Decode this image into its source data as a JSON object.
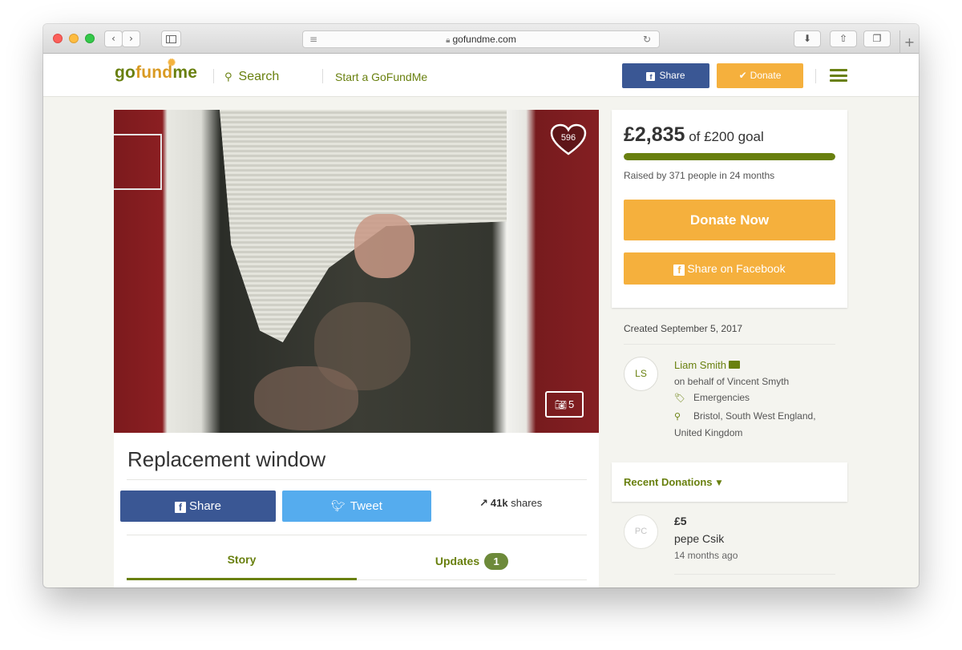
{
  "browser": {
    "url": "gofundme.com",
    "nav_back": "‹",
    "nav_forward": "›",
    "new_tab": "+"
  },
  "header": {
    "logo_go": "go",
    "logo_fund": "fund",
    "logo_me": "me",
    "search_label": "Search",
    "start_label": "Start a GoFundMe",
    "share_label": "Share",
    "donate_label": "Donate"
  },
  "campaign": {
    "hearts": "596",
    "photo_count": "5",
    "title": "Replacement window",
    "share_label": "Share",
    "tweet_label": "Tweet",
    "shares_count": "41k",
    "shares_label": "shares",
    "tabs": {
      "story": "Story",
      "updates": "Updates",
      "updates_count": "1"
    }
  },
  "donation": {
    "raised": "£2,835",
    "goal_text": "of £200 goal",
    "progress_fraction": 1.0,
    "raised_by": "Raised by 371 people in 24 months",
    "donate_now": "Donate Now",
    "share_facebook": "Share on Facebook"
  },
  "organizer": {
    "created": "Created September 5, 2017",
    "initials": "LS",
    "name": "Liam Smith",
    "behalf": "on behalf of Vincent Smyth",
    "category": "Emergencies",
    "location_line1": "Bristol, South West England,",
    "location_line2": "United Kingdom"
  },
  "recent": {
    "title": "Recent Donations",
    "items": [
      {
        "initials": "PC",
        "amount": "£5",
        "name": "pepe Csik",
        "time": "14 months ago"
      }
    ]
  },
  "colors": {
    "brand_green": "#69800f",
    "donate_orange": "#f5b03d",
    "facebook_blue": "#3a5794",
    "twitter_blue": "#55acee"
  }
}
